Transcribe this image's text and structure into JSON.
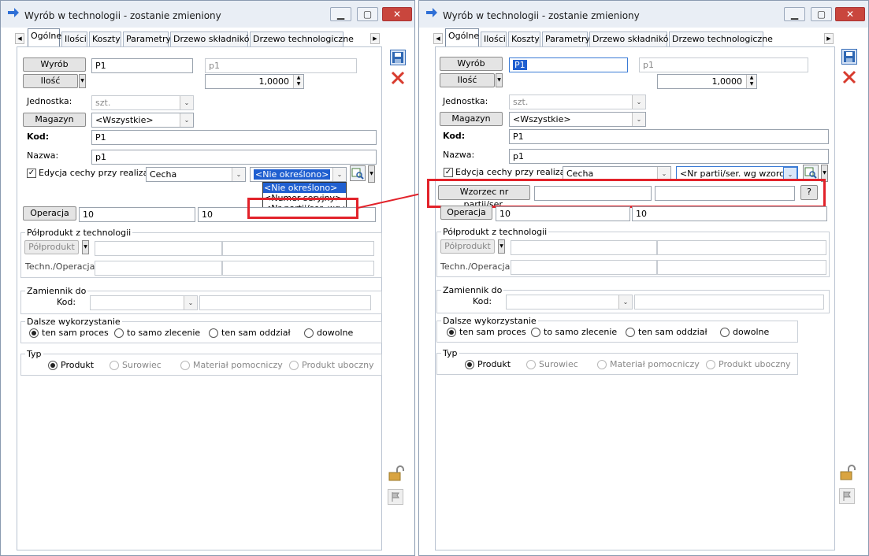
{
  "left": {
    "title": "Wyrób w technologii - zostanie zmieniony",
    "tabs": [
      "Ogólne",
      "Ilości",
      "Koszty",
      "Parametry",
      "Drzewo składników",
      "Drzewo technologiczne"
    ],
    "wyrob_btn": "Wyrób",
    "wyrob_code": "P1",
    "wyrob_name": "p1",
    "ilosc_btn": "Ilość",
    "ilosc_value": "1,0000",
    "jednostka_label": "Jednostka:",
    "jednostka_value": "szt.",
    "magazyn_btn": "Magazyn",
    "magazyn_value": "<Wszystkie>",
    "kod_label": "Kod:",
    "kod_value": "P1",
    "nazwa_label": "Nazwa:",
    "nazwa_value": "p1",
    "edycja_label": "Edycja cechy przy realizacji",
    "cecha_value": "Cecha",
    "okreslono_value": "<Nie określono>",
    "dropdown_options": [
      "<Nie określono>",
      "<Numer seryjny>",
      "<Nr partii/ser. wg wzorca>"
    ],
    "operacja_btn": "Operacja",
    "operacja_v1": "10",
    "operacja_v2": "10",
    "polprodukt_group": "Półprodukt z technologii",
    "polprodukt_btn": "Półprodukt",
    "techn_label": "Techn./Operacja:",
    "zamiennik_group": "Zamiennik do",
    "zamiennik_kod": "Kod:",
    "dalsze_group": "Dalsze wykorzystanie",
    "dalsze_options": [
      "ten sam proces",
      "to samo zlecenie",
      "ten sam oddział",
      "dowolne"
    ],
    "typ_group": "Typ",
    "typ_options": [
      "Produkt",
      "Surowiec",
      "Materiał pomocniczy",
      "Produkt uboczny"
    ]
  },
  "right": {
    "title": "Wyrób w technologii - zostanie zmieniony",
    "tabs": [
      "Ogólne",
      "Ilości",
      "Koszty",
      "Parametry",
      "Drzewo składników",
      "Drzewo technologiczne"
    ],
    "wyrob_btn": "Wyrób",
    "wyrob_code": "P1",
    "wyrob_name": "p1",
    "ilosc_btn": "Ilość",
    "ilosc_value": "1,0000",
    "jednostka_label": "Jednostka:",
    "jednostka_value": "szt.",
    "magazyn_btn": "Magazyn",
    "magazyn_value": "<Wszystkie>",
    "kod_label": "Kod:",
    "kod_value": "P1",
    "nazwa_label": "Nazwa:",
    "nazwa_value": "p1",
    "edycja_label": "Edycja cechy przy realizacji",
    "cecha_value": "Cecha",
    "wzorca_value": "<Nr partii/ser. wg wzorca>",
    "wzorzec_btn": "Wzorzec nr partii/ser.",
    "question_btn": "?",
    "operacja_btn": "Operacja",
    "operacja_v1": "10",
    "operacja_v2": "10",
    "polprodukt_group": "Półprodukt z technologii",
    "polprodukt_btn": "Półprodukt",
    "techn_label": "Techn./Operacja:",
    "zamiennik_group": "Zamiennik do",
    "zamiennik_kod": "Kod:",
    "dalsze_group": "Dalsze wykorzystanie",
    "dalsze_options": [
      "ten sam proces",
      "to samo zlecenie",
      "ten sam oddział",
      "dowolne"
    ],
    "typ_group": "Typ",
    "typ_options": [
      "Produkt",
      "Surowiec",
      "Materiał pomocniczy",
      "Produkt uboczny"
    ]
  },
  "colors": {
    "highlight": "#e2222a",
    "selection": "#1f5fd0",
    "titlebar": "#e9eef5"
  }
}
